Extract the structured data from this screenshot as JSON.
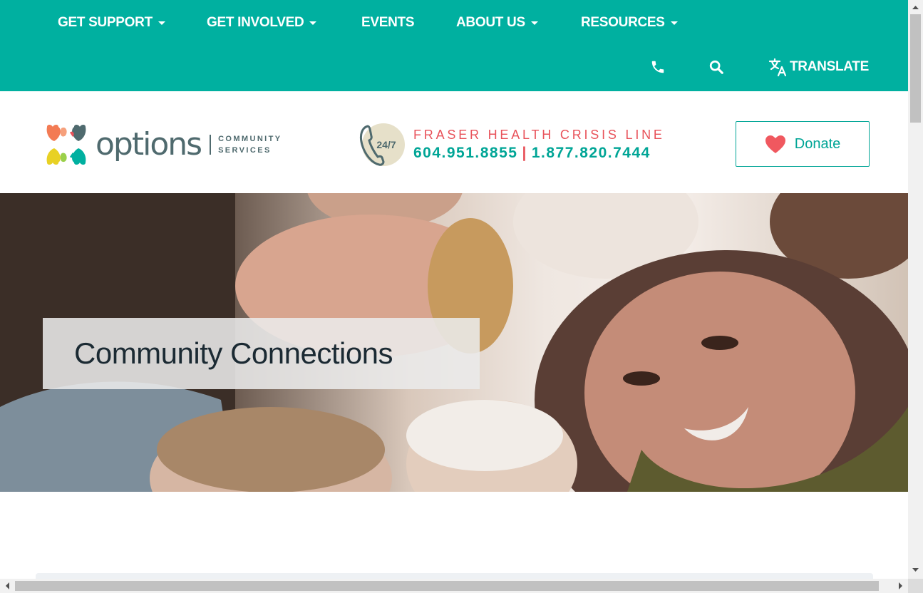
{
  "nav": {
    "items": [
      {
        "label": "GET SUPPORT",
        "dropdown": true
      },
      {
        "label": "GET INVOLVED",
        "dropdown": true
      },
      {
        "label": "EVENTS",
        "dropdown": false
      },
      {
        "label": "ABOUT US",
        "dropdown": true
      },
      {
        "label": "RESOURCES",
        "dropdown": true
      }
    ],
    "translate_label": "TRANSLATE",
    "icons": {
      "phone": "phone-icon",
      "search": "search-icon",
      "translate": "translate-icon"
    }
  },
  "header": {
    "logo": {
      "word": "options",
      "sub_line1": "COMMUNITY",
      "sub_line2": "SERVICES"
    },
    "crisis": {
      "badge": "24/7",
      "title": "FRASER HEALTH CRISIS LINE",
      "phone1": "604.951.8855",
      "separator": "|",
      "phone2": "1.877.820.7444"
    },
    "donate_label": "Donate"
  },
  "hero": {
    "title": "Community Connections"
  },
  "colors": {
    "brand_teal": "#00b0a0",
    "accent_red": "#e8525a",
    "text_dark": "#1b2a33",
    "logo_gray": "#4f6a6e"
  }
}
